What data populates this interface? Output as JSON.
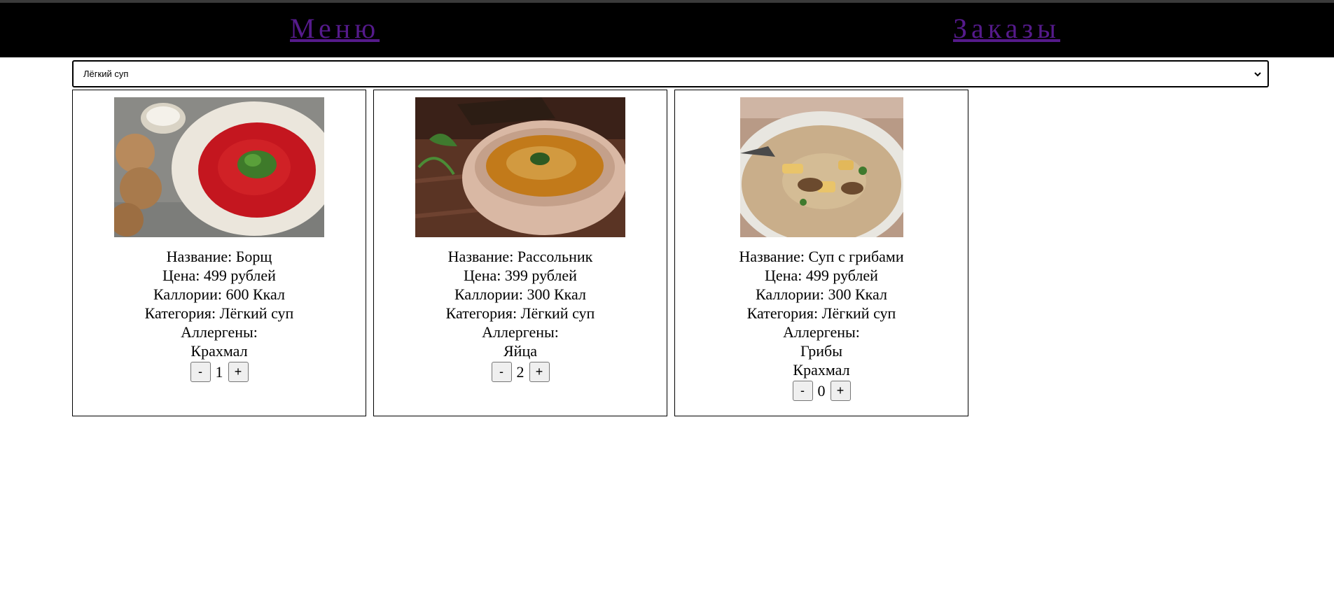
{
  "nav": {
    "menu": "Меню",
    "orders": "Заказы"
  },
  "filter": {
    "selected": "Лёгкий суп"
  },
  "labels": {
    "name": "Название: ",
    "price": "Цена: ",
    "calories": "Каллории: ",
    "category": "Категория: ",
    "allergens": "Аллергены:",
    "minus": "-",
    "plus": "+"
  },
  "dishes": [
    {
      "name": "Борщ",
      "price": "499 рублей",
      "calories": "600 Ккал",
      "category": "Лёгкий суп",
      "allergens": [
        "Крахмал"
      ],
      "quantity": "1",
      "image": "borscht-photo"
    },
    {
      "name": "Рассольник",
      "price": "399 рублей",
      "calories": "300 Ккал",
      "category": "Лёгкий суп",
      "allergens": [
        "Яйца"
      ],
      "quantity": "2",
      "image": "rassolnik-photo"
    },
    {
      "name": "Суп с грибами",
      "price": "499 рублей",
      "calories": "300 Ккал",
      "category": "Лёгкий суп",
      "allergens": [
        "Грибы",
        "Крахмал"
      ],
      "quantity": "0",
      "image": "mushroom-soup-photo"
    }
  ]
}
